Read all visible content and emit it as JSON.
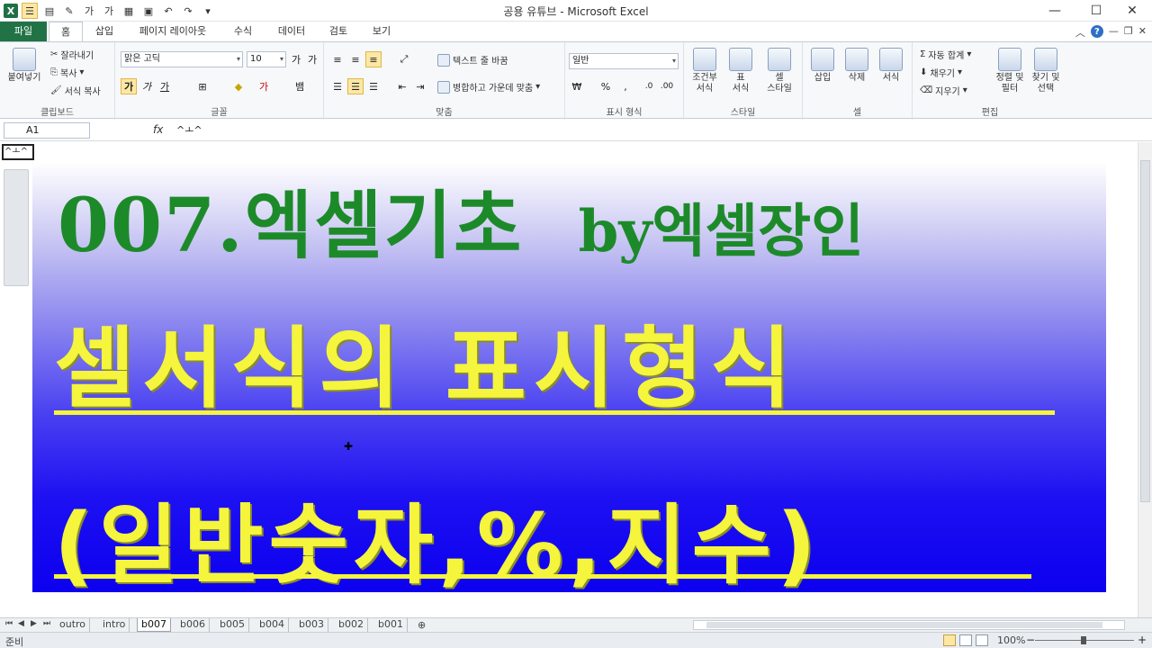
{
  "window": {
    "title": "공용 유튜브 - Microsoft Excel",
    "minimize": "—",
    "maximize": "☐",
    "close": "✕"
  },
  "qat": {
    "logo": "X",
    "undo": "↶",
    "redo": "↷",
    "more": "▾"
  },
  "tabs": [
    {
      "label": "파일"
    },
    {
      "label": "홈"
    },
    {
      "label": "삽입"
    },
    {
      "label": "페이지 레이아웃"
    },
    {
      "label": "수식"
    },
    {
      "label": "데이터"
    },
    {
      "label": "검토"
    },
    {
      "label": "보기"
    }
  ],
  "ribbon": {
    "clipboard": {
      "label": "클립보드",
      "paste": "붙여넣기",
      "cut": "잘라내기",
      "copy": "복사",
      "format_painter": "서식 복사"
    },
    "font": {
      "label": "글꼴",
      "font_name": "맑은 고딕",
      "font_size": "10",
      "bold": "가",
      "italic": "가",
      "underline": "가"
    },
    "alignment": {
      "label": "맞춤",
      "wrap_text": "텍스트 줄 바꿈",
      "merge_center": "병합하고 가운데 맞춤"
    },
    "number": {
      "label": "표시 형식",
      "format": "일반",
      "percent": "%",
      "comma": ","
    },
    "styles": {
      "label": "스타일",
      "conditional": "조건부\n서식",
      "table": "표\n서식",
      "cell_styles": "셀\n스타일"
    },
    "cells": {
      "label": "셀",
      "insert": "삽입",
      "delete": "삭제",
      "format": "서식"
    },
    "editing": {
      "label": "편집",
      "autosum": "자동 합계",
      "fill": "채우기",
      "clear": "지우기",
      "sort_filter": "정렬 및\n필터",
      "find_select": "찾기 및\n선택"
    }
  },
  "formula": {
    "name_box": "A1",
    "fx": "fx",
    "content": "^ㅗ^"
  },
  "sheet": {
    "a1_value": "^ㅗ^",
    "banner": {
      "line1_prefix": "007.엑셀기초",
      "line1_suffix": "by엑셀장인",
      "line2": "셀서식의 표시형식",
      "line3": "(일반숫자,%,지수)"
    },
    "colors": {
      "title_green": "#1d8a2a",
      "title_yellow": "#f4f53c",
      "bottom_blue": "#0c00ef"
    }
  },
  "sheet_tabs": [
    "outro",
    "intro",
    "b007",
    "b006",
    "b005",
    "b004",
    "b003",
    "b002",
    "b001"
  ],
  "active_sheet": "b007",
  "status": {
    "text": "준비",
    "zoom": "100%",
    "zoom_level_percent": 100
  }
}
